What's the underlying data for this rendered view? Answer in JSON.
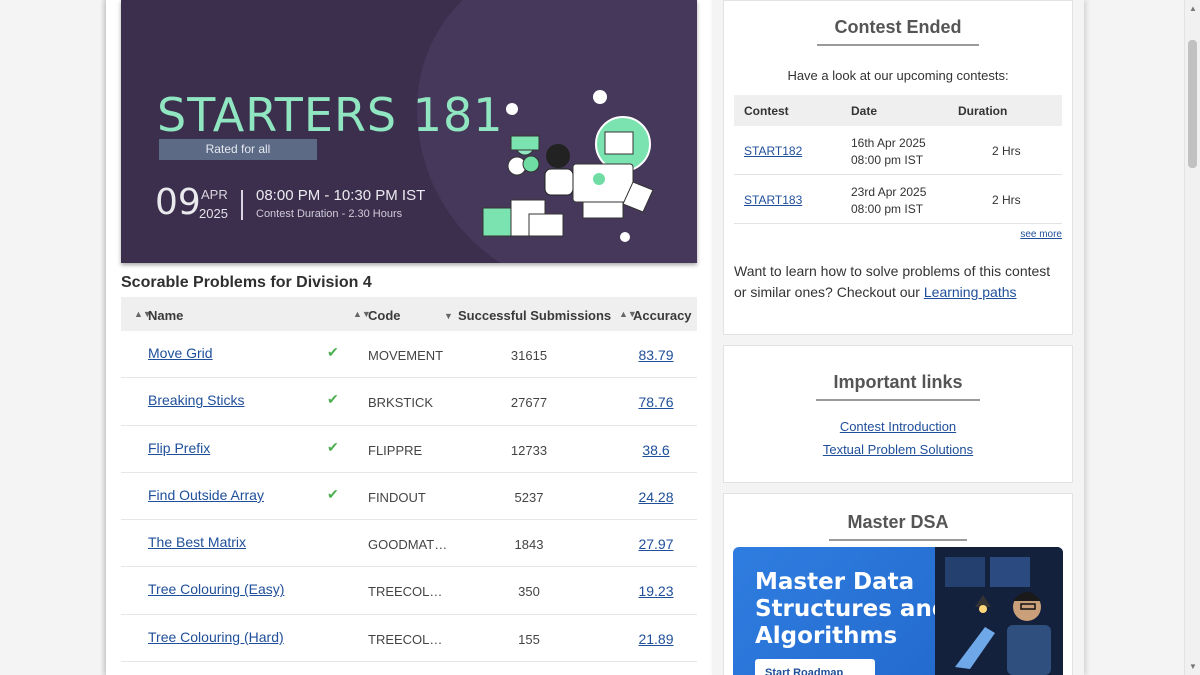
{
  "banner": {
    "title": "STARTERS 181",
    "tag": "Rated for all",
    "day": "09",
    "month": "APR",
    "year": "2025",
    "time": "08:00 PM - 10:30 PM IST",
    "duration": "Contest Duration - 2.30 Hours"
  },
  "problems": {
    "section_title": "Scorable Problems for Division 4",
    "headers": {
      "name": "Name",
      "code": "Code",
      "submissions": "Successful Submissions",
      "accuracy": "Accuracy"
    },
    "rows": [
      {
        "name": "Move Grid",
        "solved": true,
        "code": "MOVEMENT",
        "submissions": "31615",
        "accuracy": "83.79"
      },
      {
        "name": "Breaking Sticks",
        "solved": true,
        "code": "BRKSTICK",
        "submissions": "27677",
        "accuracy": "78.76"
      },
      {
        "name": "Flip Prefix",
        "solved": true,
        "code": "FLIPPRE",
        "submissions": "12733",
        "accuracy": "38.6"
      },
      {
        "name": "Find Outside Array",
        "solved": true,
        "code": "FINDOUT",
        "submissions": "5237",
        "accuracy": "24.28"
      },
      {
        "name": "The Best Matrix",
        "solved": false,
        "code": "GOODMAT…",
        "submissions": "1843",
        "accuracy": "27.97"
      },
      {
        "name": "Tree Colouring (Easy)",
        "solved": false,
        "code": "TREECOL…",
        "submissions": "350",
        "accuracy": "19.23"
      },
      {
        "name": "Tree Colouring (Hard)",
        "solved": false,
        "code": "TREECOL…",
        "submissions": "155",
        "accuracy": "21.89"
      }
    ]
  },
  "contest_ended": {
    "title": "Contest Ended",
    "subtitle": "Have a look at our upcoming contests:",
    "headers": {
      "contest": "Contest",
      "date": "Date",
      "duration": "Duration"
    },
    "rows": [
      {
        "contest": "START182",
        "date_line1": "16th Apr 2025",
        "date_line2": "08:00 pm IST",
        "duration": "2 Hrs"
      },
      {
        "contest": "START183",
        "date_line1": "23rd Apr 2025",
        "date_line2": "08:00 pm IST",
        "duration": "2 Hrs"
      }
    ],
    "see_more": "see more",
    "learn_text": "Want to learn how to solve problems of this contest or similar ones? Checkout our",
    "learn_link": "Learning paths"
  },
  "important_links": {
    "title": "Important links",
    "links": [
      "Contest Introduction",
      "Textual Problem Solutions"
    ]
  },
  "master_dsa": {
    "title": "Master DSA",
    "banner_line1": "Master Data",
    "banner_line2": "Structures and",
    "banner_line3": "Algorithms",
    "button": "Start Roadmap"
  },
  "icons": {
    "check": "check-icon",
    "sort": "sort-icon"
  },
  "colors": {
    "banner_bg": "#3b2f4d",
    "title_green": "#8fe6c0",
    "link_blue": "#1f4f9a",
    "check_green": "#4caf50"
  }
}
